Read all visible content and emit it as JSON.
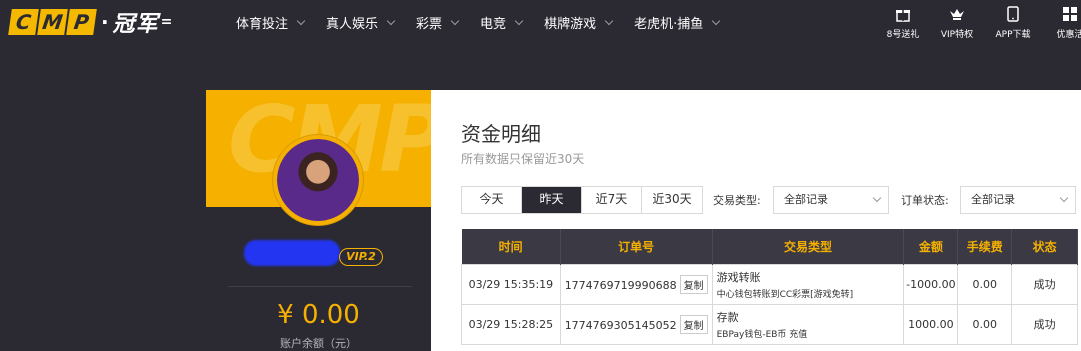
{
  "header": {
    "logo_letters": [
      "C",
      "M",
      "P"
    ],
    "logo_dot": "·",
    "logo_brand": "冠军",
    "nav": [
      {
        "label": "体育投注"
      },
      {
        "label": "真人娱乐"
      },
      {
        "label": "彩票"
      },
      {
        "label": "电竞"
      },
      {
        "label": "棋牌游戏"
      },
      {
        "label": "老虎机·捕鱼"
      }
    ],
    "quick_links": [
      {
        "label": "8号送礼",
        "icon": "gift-icon"
      },
      {
        "label": "VIP特权",
        "icon": "crown-icon"
      },
      {
        "label": "APP下载",
        "icon": "mobile-icon"
      },
      {
        "label": "优惠活",
        "icon": "grid-icon"
      }
    ]
  },
  "profile": {
    "watermark": "CMP",
    "vip_level": "VIP.2",
    "balance": "¥ 0.00",
    "balance_label": "账户余额（元）"
  },
  "main": {
    "title": "资金明细",
    "subtitle": "所有数据只保留近30天",
    "date_tabs": [
      "今天",
      "昨天",
      "近7天",
      "近30天"
    ],
    "active_tab": "昨天",
    "filter_type_label": "交易类型:",
    "filter_type_value": "全部记录",
    "filter_status_label": "订单状态:",
    "filter_status_value": "全部记录",
    "table": {
      "headers": [
        "时间",
        "订单号",
        "交易类型",
        "金额",
        "手续费",
        "状态"
      ],
      "copy_label": "复制",
      "rows": [
        {
          "time": "03/29 15:35:19",
          "order_no": "1774769719990688",
          "type_title": "游戏转账",
          "type_detail": "中心钱包转账到CC彩票[游戏免转]",
          "amount": "-1000.00",
          "fee": "0.00",
          "status": "成功"
        },
        {
          "time": "03/29 15:28:25",
          "order_no": "1774769305145052",
          "type_title": "存款",
          "type_detail": "EBPay钱包-EB币 充值",
          "amount": "1000.00",
          "fee": "0.00",
          "status": "成功"
        }
      ]
    }
  },
  "colors": {
    "accent": "#f5b000",
    "nav_bg": "#2b2a33",
    "success": "#2e9a2e"
  }
}
